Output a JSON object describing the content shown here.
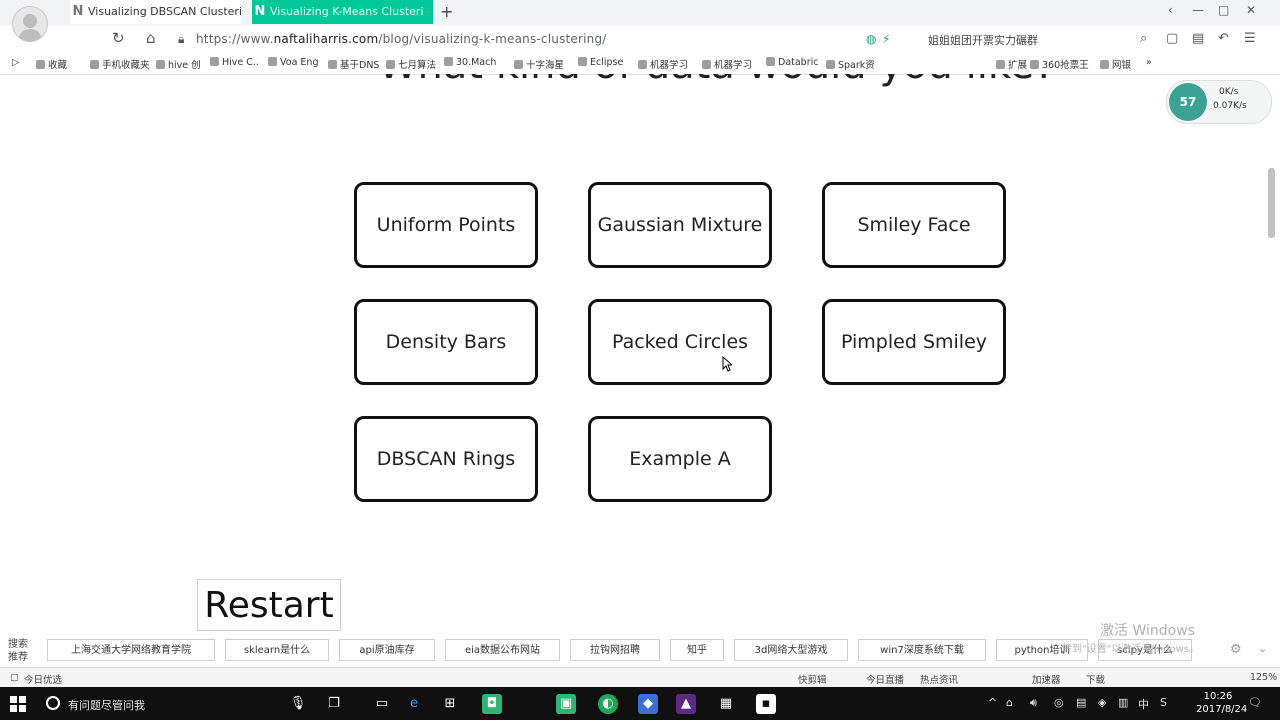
{
  "browser": {
    "tabs": [
      {
        "label": "Visualizing DBSCAN Clusterin",
        "favicon": "N"
      },
      {
        "label": "Visualizing K-Means Clusteri",
        "favicon": "N"
      }
    ],
    "new_tab": "+",
    "window_controls": [
      "‹",
      "—",
      "□",
      "✕"
    ],
    "address": {
      "scheme": "https://",
      "host_prefix": "www.",
      "host": "naftaliharris.com",
      "path": "/blog/visualizing-k-means-clustering/"
    },
    "search_hint": "姐姐姐团开票实力碾群",
    "bookmarks": [
      "收藏",
      "手机收藏夹",
      "hive 创",
      "Hive C..",
      "Voa Eng",
      "基于DNS",
      "七月算法",
      "30.Mach",
      "十字海星",
      "Eclipse",
      "机器学习",
      "机器学习",
      "Databric",
      "Spark资",
      "扩展",
      "360抢票王",
      "网银",
      "»"
    ]
  },
  "page": {
    "heading": "What kind of data would you like?",
    "options": [
      "Uniform Points",
      "Gaussian Mixture",
      "Smiley Face",
      "Density Bars",
      "Packed Circles",
      "Pimpled Smiley",
      "DBSCAN Rings",
      "Example A"
    ],
    "restart": "Restart"
  },
  "speed_widget": {
    "badge": "57",
    "up": "0K/s",
    "down": "0.07K/s"
  },
  "suggest_bar": {
    "label": "搜索推荐",
    "chips": [
      "上海交通大学网络教育学院",
      "sklearn是什么",
      "api原油库存",
      "eia数据公布网站",
      "拉钩网招聘",
      "知乎",
      "3d网络大型游戏",
      "win7深度系统下载",
      "python培训",
      "scipy是什么"
    ]
  },
  "watermark": {
    "title": "激活 Windows",
    "sub": "转到\"设置\"以激活 Windows。"
  },
  "status_bar": {
    "left": "今日优选",
    "items": [
      "快剪辑",
      "今日直播",
      "热点资讯",
      "加速器",
      "下载",
      "125%"
    ]
  },
  "taskbar": {
    "search_placeholder": "有问题尽管问我",
    "tray": [
      "^",
      "中",
      "S"
    ],
    "time": "10:26",
    "date": "2017/8/24"
  },
  "colors": {
    "active_tab": "#00c896",
    "button_border": "#111111"
  }
}
